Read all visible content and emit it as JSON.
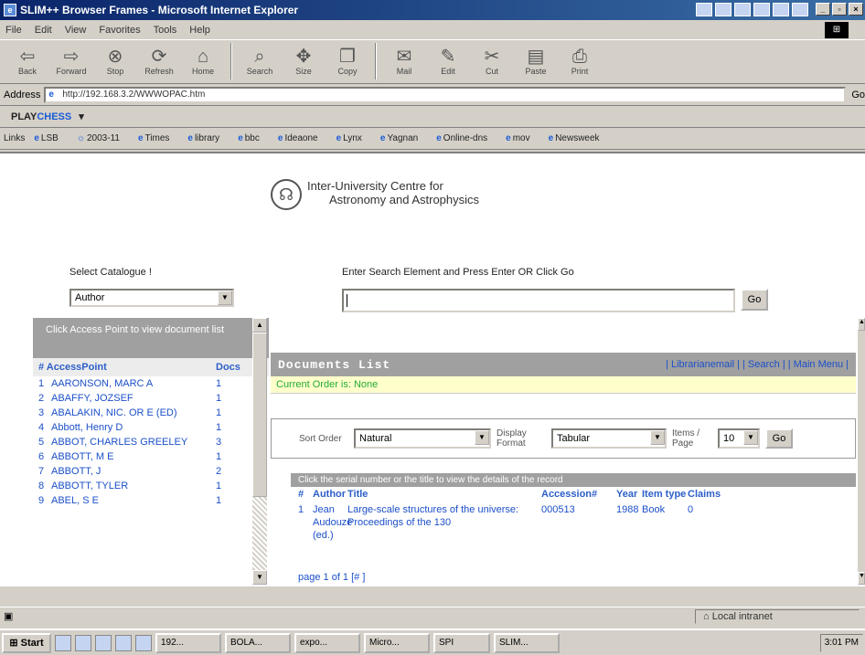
{
  "window": {
    "title": "SLIM++ Browser Frames - Microsoft Internet Explorer"
  },
  "menu": [
    "File",
    "Edit",
    "View",
    "Favorites",
    "Tools",
    "Help"
  ],
  "toolbar": [
    {
      "label": "Back",
      "icon": "back-icon"
    },
    {
      "label": "Forward",
      "icon": "forward-icon"
    },
    {
      "label": "Stop",
      "icon": "stop-icon"
    },
    {
      "label": "Refresh",
      "icon": "refresh-icon"
    },
    {
      "label": "Home",
      "icon": "home-icon"
    },
    {
      "label": "Search",
      "icon": "search-icon"
    },
    {
      "label": "Size",
      "icon": "size-icon"
    },
    {
      "label": "Copy",
      "icon": "copy-icon"
    },
    {
      "label": "Mail",
      "icon": "mail-icon"
    },
    {
      "label": "Edit",
      "icon": "edit-icon"
    },
    {
      "label": "Cut",
      "icon": "cut-icon"
    },
    {
      "label": "Paste",
      "icon": "paste-icon"
    },
    {
      "label": "Print",
      "icon": "print-icon"
    }
  ],
  "address": {
    "label": "Address",
    "value": "http://192.168.3.2/WWWOPAC.htm",
    "go": "Go"
  },
  "playbar": {
    "play": "PLAY",
    "chess": "CHESS"
  },
  "links": {
    "label": "Links",
    "items": [
      "LSB",
      "2003-11",
      "Times",
      "library",
      "bbc",
      "Ideaone",
      "Lynx",
      "Yagnan",
      "Online-dns",
      "mov",
      "Newsweek"
    ]
  },
  "header": {
    "institute_line1": "Inter-University Centre for",
    "institute_line2": "Astronomy and Astrophysics"
  },
  "search": {
    "catalogue_label": "Select Catalogue !",
    "catalogue_value": "Author",
    "prompt": "Enter Search Element and Press Enter OR Click Go",
    "value": "",
    "go_label": "Go"
  },
  "access_points": {
    "instructions": "Click Access Point to view document list",
    "col_access": "# AccessPoint",
    "col_docs": "Docs",
    "items": [
      {
        "n": "1",
        "name": "AARONSON, MARC A",
        "docs": "1"
      },
      {
        "n": "2",
        "name": "ABAFFY, JOZSEF",
        "docs": "1"
      },
      {
        "n": "3",
        "name": "ABALAKIN, NIC. OR E (ED)",
        "docs": "1"
      },
      {
        "n": "4",
        "name": "Abbott, Henry D",
        "docs": "1"
      },
      {
        "n": "5",
        "name": "ABBOT, CHARLES GREELEY",
        "docs": "3"
      },
      {
        "n": "6",
        "name": "ABBOTT, M E",
        "docs": "1"
      },
      {
        "n": "7",
        "name": "ABBOTT, J",
        "docs": "2"
      },
      {
        "n": "8",
        "name": "ABBOTT, TYLER",
        "docs": "1"
      },
      {
        "n": "9",
        "name": "ABEL, S E",
        "docs": "1"
      }
    ]
  },
  "doclist": {
    "title": "Documents List",
    "nav_links": "| Librarianemail | | Search | | Main Menu |",
    "current_order": "Current Order is: None",
    "sort_label": "Sort Order",
    "sort_value": "Natural",
    "display_label": "Display Format",
    "display_value": "Tabular",
    "items_label": "Items / Page",
    "items_value": "10",
    "go_label": "Go",
    "instructions": "Click the serial number or the title to view the details of the record",
    "columns": [
      "#",
      "Author",
      "Title",
      "Accession#",
      "Year",
      "Item type",
      "Claims"
    ],
    "rows": [
      {
        "n": "1",
        "author": "Jean Audouze (ed.)",
        "title": "Large-scale structures of the universe: Proceedings of the 130",
        "accession": "000513",
        "year": "1988",
        "type": "Book",
        "claims": "0"
      }
    ],
    "pager": "page 1 of 1 [# ]"
  },
  "status": {
    "zone": "Local intranet"
  },
  "taskbar": {
    "start": "Start",
    "tasks": [
      "192...",
      "BOLA...",
      "expo...",
      "Micro...",
      "SPI",
      "SLIM..."
    ],
    "clock": "3:01 PM"
  }
}
